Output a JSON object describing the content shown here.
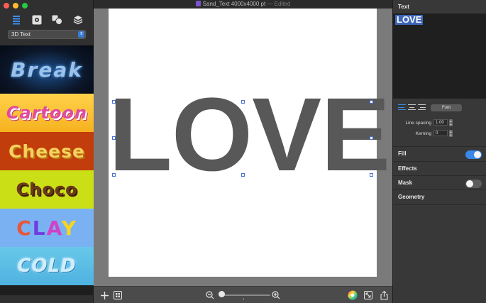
{
  "window": {
    "title": "Sand_Text 4000x4000 pt",
    "edited": "— Edited"
  },
  "sidebar": {
    "preset_category": "3D Text",
    "thumbnails": [
      {
        "name": "break",
        "label": "Break"
      },
      {
        "name": "cartoon",
        "label": "Cartoon"
      },
      {
        "name": "cheese",
        "label": "Cheese"
      },
      {
        "name": "choco",
        "label": "Choco"
      },
      {
        "name": "clay",
        "label": "CLAY"
      },
      {
        "name": "cold",
        "label": "COLD"
      }
    ]
  },
  "canvas": {
    "text": "LOVE",
    "text_color": "#585858"
  },
  "panel": {
    "text_section": "Text",
    "text_value": "LOVE",
    "font_button": "Font",
    "line_spacing_label": "Line spacing",
    "line_spacing_value": "1.00",
    "kerning_label": "Kerning",
    "kerning_value": "0",
    "fill_label": "Fill",
    "fill_on": true,
    "effects_label": "Effects",
    "mask_label": "Mask",
    "mask_on": false,
    "geometry_label": "Geometry"
  },
  "colors": {
    "accent": "#3a87ea",
    "selection": "#3d66b8"
  },
  "icons": {
    "tabs": [
      "list-icon",
      "gear-icon",
      "shapes-icon",
      "layers-icon"
    ],
    "bottom": [
      "add-icon",
      "grid-icon",
      "zoom-out-icon",
      "zoom-in-icon",
      "color-wheel-icon",
      "fit-icon",
      "share-icon"
    ]
  }
}
